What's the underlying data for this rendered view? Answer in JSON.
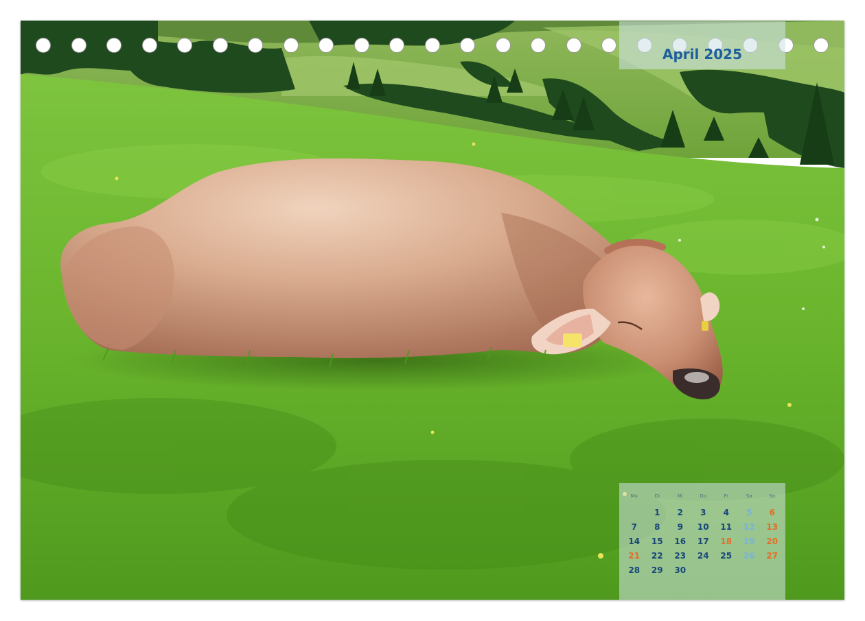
{
  "month_label": "April 2025",
  "weekdays": [
    "Mo",
    "Di",
    "Mi",
    "Do",
    "Fr",
    "Sa",
    "So"
  ],
  "days": [
    {
      "day": "",
      "kind": "blank"
    },
    {
      "day": "1",
      "kind": "work"
    },
    {
      "day": "2",
      "kind": "work"
    },
    {
      "day": "3",
      "kind": "work"
    },
    {
      "day": "4",
      "kind": "work"
    },
    {
      "day": "5",
      "kind": "sat"
    },
    {
      "day": "6",
      "kind": "sun"
    },
    {
      "day": "7",
      "kind": "work"
    },
    {
      "day": "8",
      "kind": "work"
    },
    {
      "day": "9",
      "kind": "work"
    },
    {
      "day": "10",
      "kind": "work"
    },
    {
      "day": "11",
      "kind": "work"
    },
    {
      "day": "12",
      "kind": "sat"
    },
    {
      "day": "13",
      "kind": "sun"
    },
    {
      "day": "14",
      "kind": "work"
    },
    {
      "day": "15",
      "kind": "work"
    },
    {
      "day": "16",
      "kind": "work"
    },
    {
      "day": "17",
      "kind": "work"
    },
    {
      "day": "18",
      "kind": "hol"
    },
    {
      "day": "19",
      "kind": "sat"
    },
    {
      "day": "20",
      "kind": "sun"
    },
    {
      "day": "21",
      "kind": "hol"
    },
    {
      "day": "22",
      "kind": "work"
    },
    {
      "day": "23",
      "kind": "work"
    },
    {
      "day": "24",
      "kind": "work"
    },
    {
      "day": "25",
      "kind": "work"
    },
    {
      "day": "26",
      "kind": "sat"
    },
    {
      "day": "27",
      "kind": "sun"
    },
    {
      "day": "28",
      "kind": "work"
    },
    {
      "day": "29",
      "kind": "work"
    },
    {
      "day": "30",
      "kind": "work"
    }
  ],
  "colors": {
    "title": "#1d5f9c",
    "weekday": "#17457a",
    "saturday": "#7ab3d4",
    "sunday_holiday": "#e86a26"
  },
  "ring_holes": 23,
  "photo_subject": "brown-cow-lying-on-alpine-meadow"
}
